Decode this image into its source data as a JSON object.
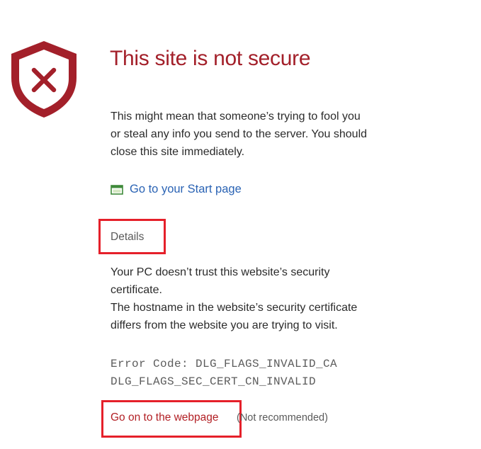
{
  "colors": {
    "alert_red": "#a3202a",
    "link_blue": "#2a63b4",
    "highlight_red": "#e5202a",
    "body_text": "#2b2b2b"
  },
  "icons": {
    "shield": "shield-x-icon",
    "start_page": "start-page-icon"
  },
  "header": {
    "title": "This site is not secure"
  },
  "description": {
    "line1": "This might mean that someone’s trying to fool you",
    "line2": "or steal any info you send to the server. You should",
    "line3": "close this site immediately."
  },
  "actions": {
    "start_page_label": "Go to your Start page",
    "details_label": "Details",
    "go_on_label": "Go on to the webpage",
    "go_on_note": "(Not recommended)"
  },
  "details": {
    "trust_line1": "Your PC doesn’t trust this website’s security",
    "trust_line2": "certificate.",
    "host_line1": "The hostname in the website’s security certificate",
    "host_line2": "differs from the website you are trying to visit.",
    "error_line1": "Error Code: DLG_FLAGS_INVALID_CA",
    "error_line2": "DLG_FLAGS_SEC_CERT_CN_INVALID"
  }
}
